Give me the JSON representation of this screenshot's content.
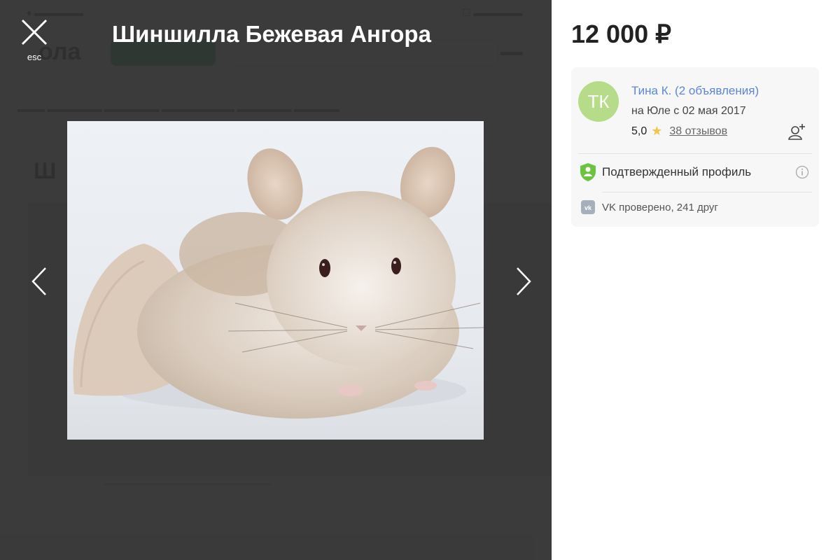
{
  "gallery": {
    "title": "Шиншилла Бежевая Ангора",
    "close_label": "esc"
  },
  "listing": {
    "price": "12 000 ₽"
  },
  "seller": {
    "initials": "ТК",
    "name": "Тина К. (2 объявления)",
    "member_since": "на Юле с 02 мая 2017",
    "rating": "5,0",
    "reviews": "38 отзывов",
    "verified": "Подтвержденный профиль",
    "vk": "VK проверено, 241 друг"
  },
  "colors": {
    "avatar": "#b6dc89",
    "link": "#5b86d8",
    "star": "#f6c342",
    "verified": "#6cc33f",
    "overlay": "#303030"
  },
  "icons": [
    "close-icon",
    "chevron-left-icon",
    "chevron-right-icon",
    "star-icon",
    "add-user-icon",
    "shield-check-icon",
    "info-icon",
    "vk-icon"
  ]
}
